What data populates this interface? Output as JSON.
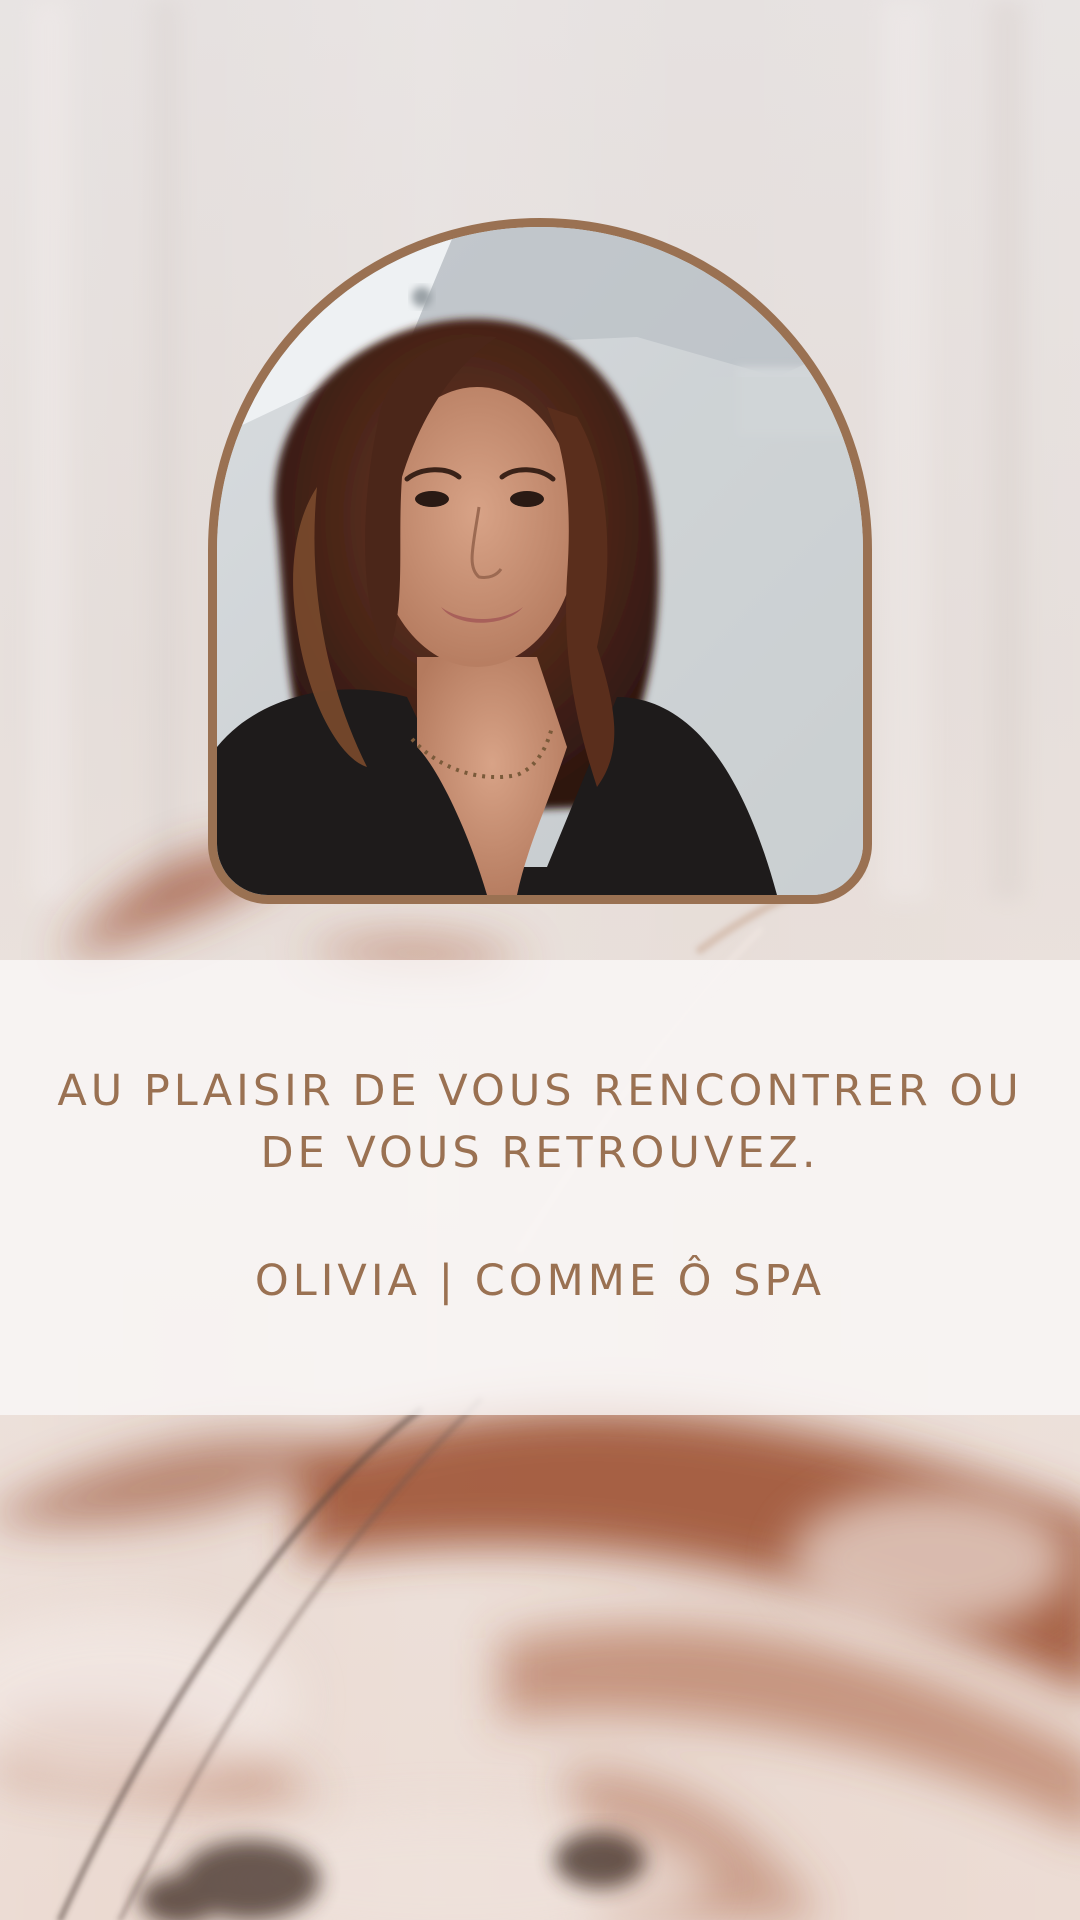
{
  "card": {
    "message_line_1": "AU PLAISIR DE VOUS RENCONTRER OU",
    "message_line_2": "DE VOUS RETROUVEZ.",
    "signature": "OLIVIA | COMME Ô SPA"
  },
  "colors": {
    "accent": "#9a7152",
    "band": "#faf8f7",
    "background": "#e6e0dd"
  }
}
